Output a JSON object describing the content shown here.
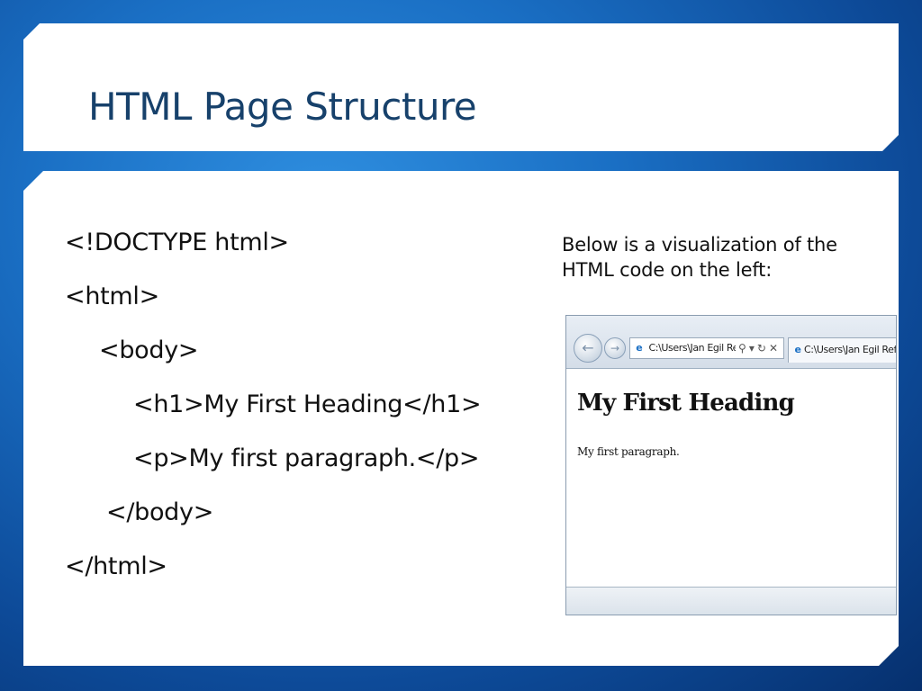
{
  "slide": {
    "title": "HTML Page Structure",
    "code_lines": [
      "<!DOCTYPE html>",
      "<html>",
      "<body>",
      "<h1>My First Heading</h1>",
      "<p>My first paragraph.</p>",
      "</body>",
      "</html>"
    ],
    "side_text": "Below is a visualization of the HTML code on the left:"
  },
  "browser": {
    "address_text": "C:\\Users\\Jan Egil Re",
    "tab_text": "C:\\Users\\Jan Egil Ref",
    "heading": "My First Heading",
    "paragraph": "My first paragraph.",
    "icons": [
      "back-arrow-icon",
      "forward-arrow-icon",
      "ie-page-icon",
      "search-icon",
      "refresh-icon",
      "close-icon"
    ]
  },
  "colors": {
    "title": "#17416b",
    "background": "#1a6fc4"
  }
}
